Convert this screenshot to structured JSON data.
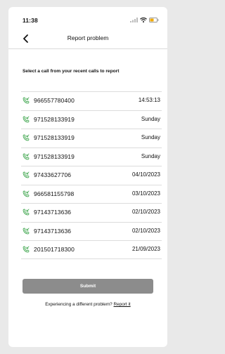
{
  "status_bar": {
    "time": "11:38"
  },
  "header": {
    "title": "Report problem"
  },
  "prompt": "Select a call from your recent calls to report",
  "calls": [
    {
      "number": "966557780400",
      "time": "14:53:13"
    },
    {
      "number": "971528133919",
      "time": "Sunday"
    },
    {
      "number": "971528133919",
      "time": "Sunday"
    },
    {
      "number": "971528133919",
      "time": "Sunday"
    },
    {
      "number": "97433627706",
      "time": "04/10/2023"
    },
    {
      "number": "966581155798",
      "time": "03/10/2023"
    },
    {
      "number": "97143713636",
      "time": "02/10/2023"
    },
    {
      "number": "97143713636",
      "time": "02/10/2023"
    },
    {
      "number": "201501718300",
      "time": "21/09/2023"
    }
  ],
  "submit_label": "Submit",
  "footer": {
    "text": "Experiencing a different problem?",
    "link": "Report it"
  },
  "icons": {
    "call": "incoming-call-icon",
    "back": "chevron-left-icon"
  },
  "colors": {
    "call_icon": "#2e9e3e",
    "submit_bg": "#8c8c8c"
  }
}
